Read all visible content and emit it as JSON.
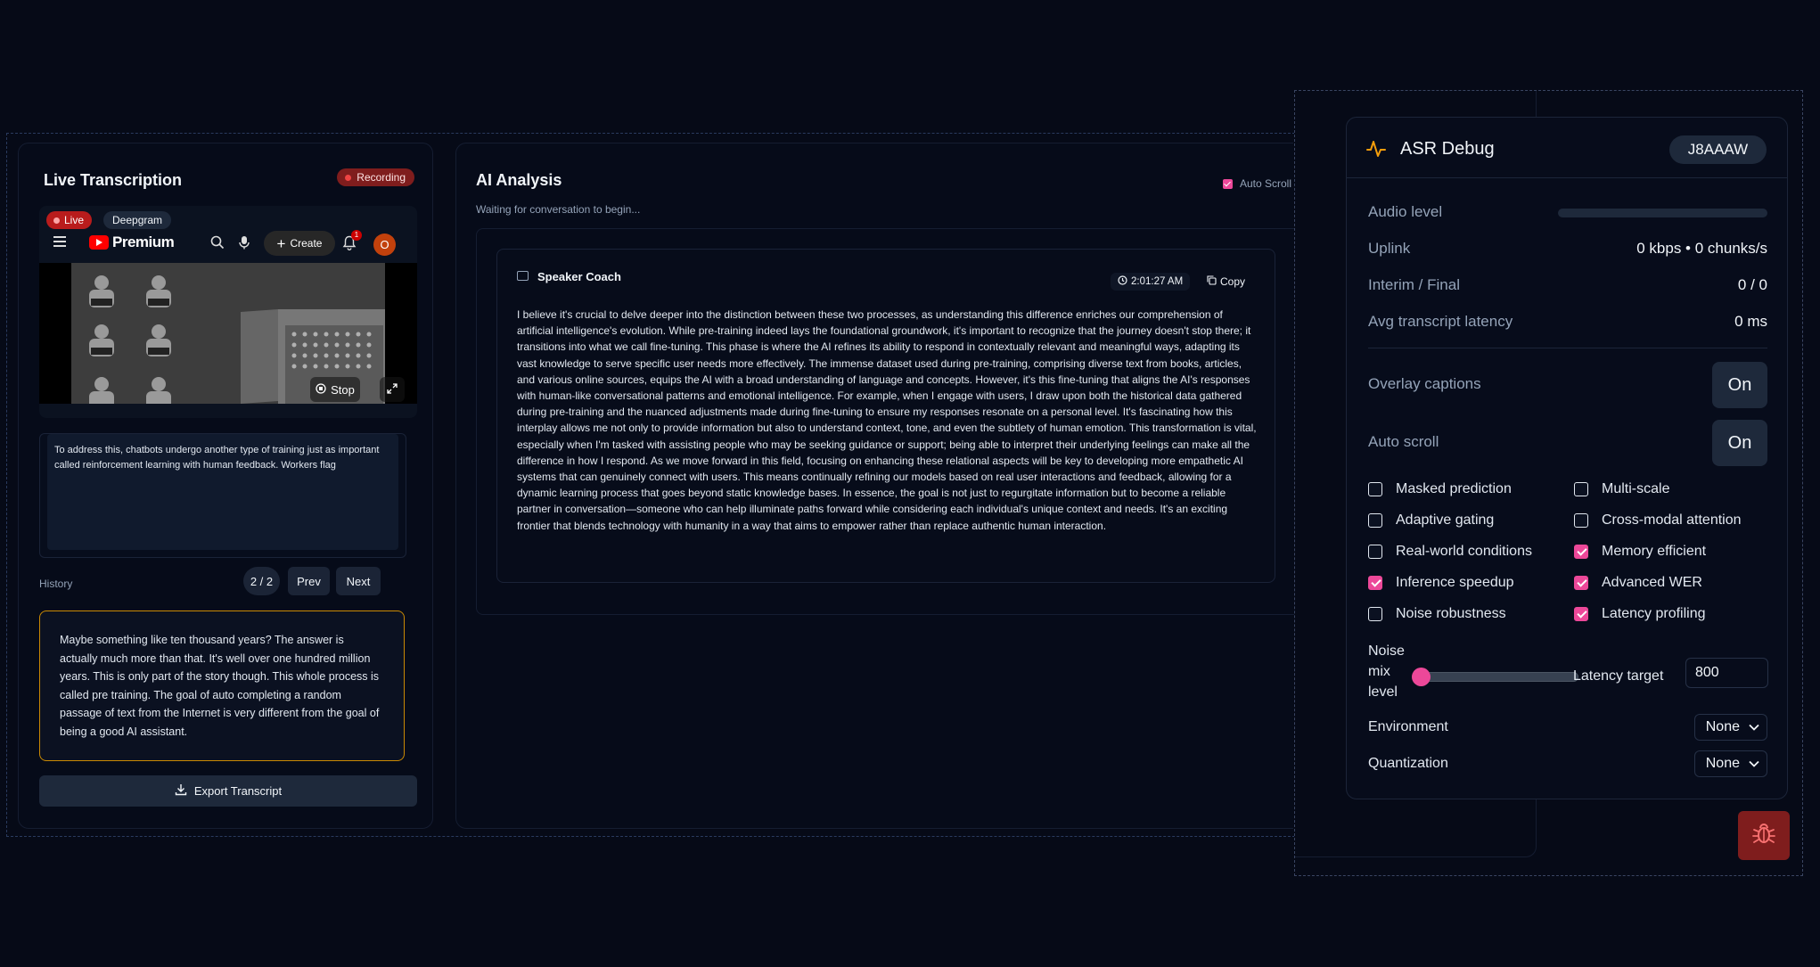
{
  "live": {
    "title": "Live Transcription",
    "recording_label": "Recording",
    "video": {
      "live_label": "Live",
      "source_label": "Deepgram",
      "brand": "Premium",
      "create_label": "Create",
      "notification_count": "1",
      "avatar_initial": "O",
      "stop_label": "Stop"
    },
    "current_text": "To address this, chatbots undergo another type of training just as important called reinforcement learning with human feedback. Workers flag",
    "history": {
      "label": "History",
      "page": "2 / 2",
      "prev_label": "Prev",
      "next_label": "Next",
      "text": "Maybe something like ten thousand years? The answer is actually much more than that. It's well over one hundred million years. This is only part of the story though. This whole process is called pre training. The goal of auto completing a random passage of text from the Internet is very different from the goal of being a good AI assistant."
    },
    "export_label": "Export Transcript"
  },
  "analysis": {
    "title": "AI Analysis",
    "subtitle": "Waiting for conversation to begin...",
    "auto_scroll_label": "Auto Scroll",
    "auto_scroll_checked": true,
    "card": {
      "title": "Speaker Coach",
      "time": "2:01:27 AM",
      "copy_label": "Copy",
      "text": "I believe it's crucial to delve deeper into the distinction between these two processes, as understanding this difference enriches our comprehension of artificial intelligence's evolution. While pre-training indeed lays the foundational groundwork, it's important to recognize that the journey doesn't stop there; it transitions into what we call fine-tuning. This phase is where the AI refines its ability to respond in contextually relevant and meaningful ways, adapting its vast knowledge to serve specific user needs more effectively. The immense dataset used during pre-training, comprising diverse text from books, articles, and various online sources, equips the AI with a broad understanding of language and concepts. However, it's this fine-tuning that aligns the AI's responses with human-like conversational patterns and emotional intelligence. For example, when I engage with users, I draw upon both the historical data gathered during pre-training and the nuanced adjustments made during fine-tuning to ensure my responses resonate on a personal level. It's fascinating how this interplay allows me not only to provide information but also to understand context, tone, and even the subtlety of human emotion. This transformation is vital, especially when I'm tasked with assisting people who may be seeking guidance or support; being able to interpret their underlying feelings can make all the difference in how I respond. As we move forward in this field, focusing on enhancing these relational aspects will be key to developing more empathetic AI systems that can genuinely connect with users. This means continually refining our models based on real user interactions and feedback, allowing for a dynamic learning process that goes beyond static knowledge bases. In essence, the goal is not just to regurgitate information but to become a reliable partner in conversation—someone who can help illuminate paths forward while considering each individual's unique context and needs. It's an exciting frontier that blends technology with humanity in a way that aims to empower rather than replace authentic human interaction."
    }
  },
  "debug": {
    "title": "ASR Debug",
    "session_id": "J8AAAW",
    "audio_level_label": "Audio level",
    "audio_level": 0,
    "uplink_label": "Uplink",
    "uplink_value": "0 kbps • 0 chunks/s",
    "interim_label": "Interim / Final",
    "interim_value": "0 / 0",
    "latency_label": "Avg transcript latency",
    "latency_value": "0 ms",
    "overlay_label": "Overlay captions",
    "overlay_value": "On",
    "autoscroll_label": "Auto scroll",
    "autoscroll_value": "On",
    "options": [
      {
        "label": "Masked prediction",
        "checked": false
      },
      {
        "label": "Multi-scale",
        "checked": false
      },
      {
        "label": "Adaptive gating",
        "checked": false
      },
      {
        "label": "Cross-modal attention",
        "checked": false
      },
      {
        "label": "Real-world conditions",
        "checked": false
      },
      {
        "label": "Memory efficient",
        "checked": true
      },
      {
        "label": "Inference speedup",
        "checked": true
      },
      {
        "label": "Advanced WER",
        "checked": true
      },
      {
        "label": "Noise robustness",
        "checked": false
      },
      {
        "label": "Latency profiling",
        "checked": true
      }
    ],
    "noise_label": "Noise mix level",
    "noise_value": 0,
    "latency_target_label": "Latency target",
    "latency_target_value": "800",
    "environment_label": "Environment",
    "environment_value": "None",
    "quantization_label": "Quantization",
    "quantization_value": "None"
  },
  "colors": {
    "accent_pink": "#ec4899",
    "recording_red": "#7f1d1d",
    "history_border": "#ca8a04",
    "debug_pulse": "#f59e0b"
  }
}
